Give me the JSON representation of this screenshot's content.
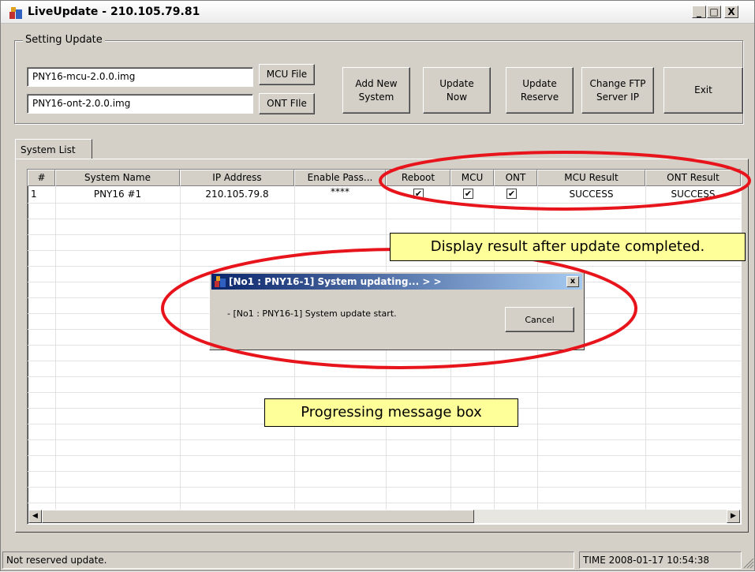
{
  "window": {
    "title": "LiveUpdate - 210.105.79.81",
    "minimize": "_",
    "maximize": "□",
    "close": "X"
  },
  "setting": {
    "group_label": "Setting Update",
    "mcu_file_value": "PNY16-mcu-2.0.0.img",
    "ont_file_value": "PNY16-ont-2.0.0.img",
    "mcu_button": "MCU File",
    "ont_button": "ONT FIle",
    "add_new_system": "Add New\nSystem",
    "update_now": "Update\nNow",
    "update_reserve": "Update\nReserve",
    "change_ftp": "Change FTP\nServer IP",
    "exit": "Exit"
  },
  "tabs": {
    "system_list": "System List"
  },
  "table": {
    "columns": [
      "#",
      "System Name",
      "IP Address",
      "Enable Pass...",
      "Reboot",
      "MCU",
      "ONT",
      "MCU Result",
      "ONT Result"
    ],
    "rows": [
      {
        "num": "1",
        "system_name": "PNY16 #1",
        "ip": "210.105.79.8",
        "pass": "****",
        "reboot": true,
        "mcu": true,
        "ont": true,
        "mcu_result": "SUCCESS",
        "ont_result": "SUCCESS"
      }
    ]
  },
  "dialog": {
    "title": "[No1 : PNY16-1] System updating... > >",
    "message": "- [No1 : PNY16-1] System update start.",
    "cancel": "Cancel",
    "close": "x"
  },
  "annotations": {
    "result_callout": "Display result after update completed.",
    "progress_callout": "Progressing message box",
    "circle_color": "#e8141c"
  },
  "status": {
    "left": "Not reserved update.",
    "right": "TIME 2008-01-17 10:54:38"
  },
  "icons": {
    "app": "app-icon",
    "check": "checkmark-icon",
    "left_arrow": "scroll-left-icon",
    "right_arrow": "scroll-right-icon"
  }
}
